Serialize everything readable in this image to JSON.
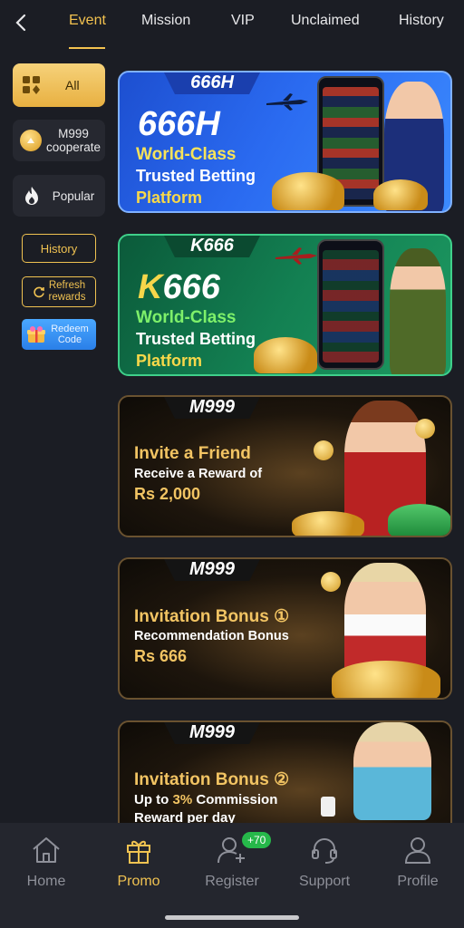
{
  "nav": {
    "tabs": [
      {
        "label": "Event",
        "active": true
      },
      {
        "label": "Mission",
        "active": false
      },
      {
        "label": "VIP",
        "active": false
      },
      {
        "label": "Unclaimed",
        "active": false
      },
      {
        "label": "History",
        "active": false
      }
    ]
  },
  "sidebar": {
    "all_label": "All",
    "m999_label": "M999\ncooperate",
    "popular_label": "Popular",
    "history_label": "History",
    "refresh_label": "Refresh\nrewards",
    "redeem_label": "Redeem\nCode"
  },
  "banners": {
    "b1": {
      "brand": "666H",
      "logo": "666H",
      "line1": "World-Class",
      "line2": "Trusted Betting",
      "line3": "Platform"
    },
    "b2": {
      "brand": "K666",
      "logo_k": "K",
      "logo_rest": "666",
      "line1": "World-Class",
      "line2": "Trusted Betting",
      "line3": "Platform"
    },
    "b3": {
      "brand": "M999",
      "a": "Invite a Friend",
      "b": "Receive a Reward of",
      "c": "Rs 2,000"
    },
    "b4": {
      "brand": "M999",
      "a": "Invitation Bonus ①",
      "b": "Recommendation Bonus",
      "c": "Rs 666"
    },
    "b5": {
      "brand": "M999",
      "a": "Invitation Bonus ②",
      "b_pre": "Up to ",
      "b_hl": "3%",
      "b_post": " Commission",
      "c": "Reward per day"
    }
  },
  "bottom_nav": {
    "items": [
      {
        "label": "Home",
        "icon": "home-icon",
        "active": false
      },
      {
        "label": "Promo",
        "icon": "gift-icon",
        "active": true
      },
      {
        "label": "Register",
        "icon": "add-user-icon",
        "active": false
      },
      {
        "label": "Support",
        "icon": "headset-icon",
        "active": false
      },
      {
        "label": "Profile",
        "icon": "user-icon",
        "active": false
      }
    ],
    "register_badge": "+70"
  },
  "colors": {
    "accent": "#f0c251",
    "background": "#1b1d24",
    "bottom_bar": "#24262e"
  }
}
